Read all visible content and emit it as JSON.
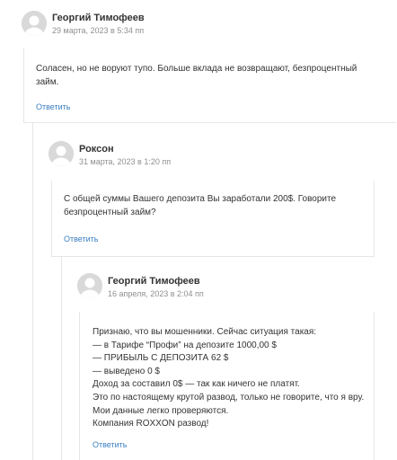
{
  "comments": [
    {
      "author": "Георгий Тимофеев",
      "date": "29 марта, 2023 в 5:34 пп",
      "lines": [
        "Соласен, но не воруют тупо. Больше вклада не возвращают, безпроцентный",
        "займ."
      ],
      "reply_label": "Ответить",
      "avatar_icon": "default-user-avatar-icon"
    },
    {
      "author": "Роксон",
      "date": "31 марта, 2023 в 1:20 пп",
      "lines": [
        "С общей суммы Вашего депозита Вы заработали 200$. Говорите",
        "безпроцентный займ?"
      ],
      "reply_label": "Ответить",
      "avatar_icon": "default-user-avatar-icon"
    },
    {
      "author": "Георгий Тимофеев",
      "date": "16 апреля, 2023 в 2:04 пп",
      "lines": [
        "Признаю, что вы мошенники. Сейчас ситуация такая:",
        "— в Тарифе “Профи” на депозите 1000,00 $",
        "— ПРИБЫЛЬ С ДЕПОЗИТА 62 $",
        "— выведено 0 $",
        "Доход за составил 0$ — так как ничего не платят.",
        "Это по настоящему крутой развод, только не говорите, что я вру.",
        "Мои данные легко проверяются.",
        "Компания ROXXON развод!"
      ],
      "reply_label": "Ответить",
      "avatar_icon": "default-user-avatar-icon"
    }
  ],
  "colors": {
    "link": "#3a7fc1",
    "border": "#e6e6e6",
    "meta": "#8f8f8f",
    "avatar_bg": "#d9d9d9"
  }
}
